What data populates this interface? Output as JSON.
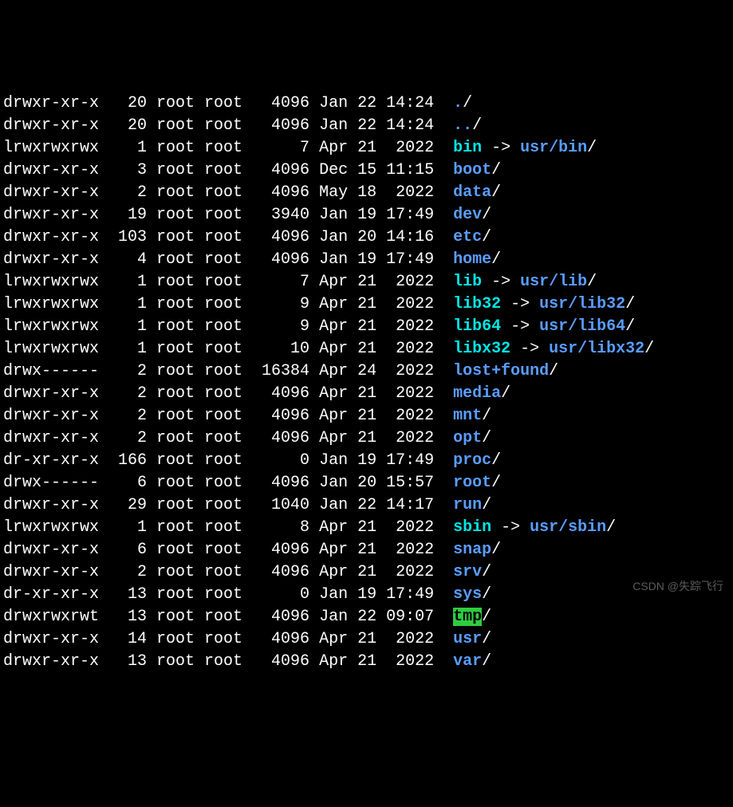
{
  "watermark": "CSDN @失踪飞行",
  "entries": [
    {
      "perm": "drwxr-xr-x",
      "links": "20",
      "own": "root",
      "grp": "root",
      "size": "4096",
      "date": "Jan 22 14:24",
      "name": ".",
      "kind": "dir"
    },
    {
      "perm": "drwxr-xr-x",
      "links": "20",
      "own": "root",
      "grp": "root",
      "size": "4096",
      "date": "Jan 22 14:24",
      "name": "..",
      "kind": "dir"
    },
    {
      "perm": "lrwxrwxrwx",
      "links": "1",
      "own": "root",
      "grp": "root",
      "size": "7",
      "date": "Apr 21  2022",
      "name": "bin",
      "kind": "sym",
      "target": "usr/bin"
    },
    {
      "perm": "drwxr-xr-x",
      "links": "3",
      "own": "root",
      "grp": "root",
      "size": "4096",
      "date": "Dec 15 11:15",
      "name": "boot",
      "kind": "dir"
    },
    {
      "perm": "drwxr-xr-x",
      "links": "2",
      "own": "root",
      "grp": "root",
      "size": "4096",
      "date": "May 18  2022",
      "name": "data",
      "kind": "dir"
    },
    {
      "perm": "drwxr-xr-x",
      "links": "19",
      "own": "root",
      "grp": "root",
      "size": "3940",
      "date": "Jan 19 17:49",
      "name": "dev",
      "kind": "dir"
    },
    {
      "perm": "drwxr-xr-x",
      "links": "103",
      "own": "root",
      "grp": "root",
      "size": "4096",
      "date": "Jan 20 14:16",
      "name": "etc",
      "kind": "dir"
    },
    {
      "perm": "drwxr-xr-x",
      "links": "4",
      "own": "root",
      "grp": "root",
      "size": "4096",
      "date": "Jan 19 17:49",
      "name": "home",
      "kind": "dir"
    },
    {
      "perm": "lrwxrwxrwx",
      "links": "1",
      "own": "root",
      "grp": "root",
      "size": "7",
      "date": "Apr 21  2022",
      "name": "lib",
      "kind": "sym",
      "target": "usr/lib"
    },
    {
      "perm": "lrwxrwxrwx",
      "links": "1",
      "own": "root",
      "grp": "root",
      "size": "9",
      "date": "Apr 21  2022",
      "name": "lib32",
      "kind": "sym",
      "target": "usr/lib32"
    },
    {
      "perm": "lrwxrwxrwx",
      "links": "1",
      "own": "root",
      "grp": "root",
      "size": "9",
      "date": "Apr 21  2022",
      "name": "lib64",
      "kind": "sym",
      "target": "usr/lib64"
    },
    {
      "perm": "lrwxrwxrwx",
      "links": "1",
      "own": "root",
      "grp": "root",
      "size": "10",
      "date": "Apr 21  2022",
      "name": "libx32",
      "kind": "sym",
      "target": "usr/libx32"
    },
    {
      "perm": "drwx------",
      "links": "2",
      "own": "root",
      "grp": "root",
      "size": "16384",
      "date": "Apr 24  2022",
      "name": "lost+found",
      "kind": "dir"
    },
    {
      "perm": "drwxr-xr-x",
      "links": "2",
      "own": "root",
      "grp": "root",
      "size": "4096",
      "date": "Apr 21  2022",
      "name": "media",
      "kind": "dir"
    },
    {
      "perm": "drwxr-xr-x",
      "links": "2",
      "own": "root",
      "grp": "root",
      "size": "4096",
      "date": "Apr 21  2022",
      "name": "mnt",
      "kind": "dir"
    },
    {
      "perm": "drwxr-xr-x",
      "links": "2",
      "own": "root",
      "grp": "root",
      "size": "4096",
      "date": "Apr 21  2022",
      "name": "opt",
      "kind": "dir"
    },
    {
      "perm": "dr-xr-xr-x",
      "links": "166",
      "own": "root",
      "grp": "root",
      "size": "0",
      "date": "Jan 19 17:49",
      "name": "proc",
      "kind": "dir"
    },
    {
      "perm": "drwx------",
      "links": "6",
      "own": "root",
      "grp": "root",
      "size": "4096",
      "date": "Jan 20 15:57",
      "name": "root",
      "kind": "dir"
    },
    {
      "perm": "drwxr-xr-x",
      "links": "29",
      "own": "root",
      "grp": "root",
      "size": "1040",
      "date": "Jan 22 14:17",
      "name": "run",
      "kind": "dir"
    },
    {
      "perm": "lrwxrwxrwx",
      "links": "1",
      "own": "root",
      "grp": "root",
      "size": "8",
      "date": "Apr 21  2022",
      "name": "sbin",
      "kind": "sym",
      "target": "usr/sbin"
    },
    {
      "perm": "drwxr-xr-x",
      "links": "6",
      "own": "root",
      "grp": "root",
      "size": "4096",
      "date": "Apr 21  2022",
      "name": "snap",
      "kind": "dir"
    },
    {
      "perm": "drwxr-xr-x",
      "links": "2",
      "own": "root",
      "grp": "root",
      "size": "4096",
      "date": "Apr 21  2022",
      "name": "srv",
      "kind": "dir"
    },
    {
      "perm": "dr-xr-xr-x",
      "links": "13",
      "own": "root",
      "grp": "root",
      "size": "0",
      "date": "Jan 19 17:49",
      "name": "sys",
      "kind": "dir"
    },
    {
      "perm": "drwxrwxrwt",
      "links": "13",
      "own": "root",
      "grp": "root",
      "size": "4096",
      "date": "Jan 22 09:07",
      "name": "tmp",
      "kind": "sticky"
    },
    {
      "perm": "drwxr-xr-x",
      "links": "14",
      "own": "root",
      "grp": "root",
      "size": "4096",
      "date": "Apr 21  2022",
      "name": "usr",
      "kind": "dir"
    },
    {
      "perm": "drwxr-xr-x",
      "links": "13",
      "own": "root",
      "grp": "root",
      "size": "4096",
      "date": "Apr 21  2022",
      "name": "var",
      "kind": "dir"
    }
  ]
}
